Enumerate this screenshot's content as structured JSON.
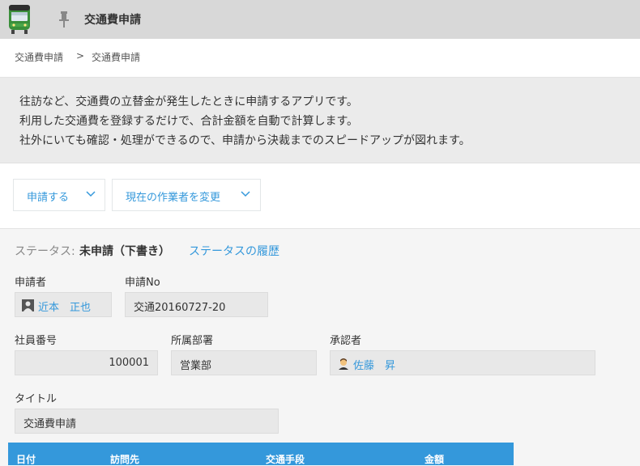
{
  "header": {
    "app_title": "交通費申請",
    "app_icon": "train-icon",
    "pin_icon": "pin-icon"
  },
  "breadcrumb": {
    "items": [
      "交通費申請",
      "交通費申請"
    ],
    "separator": ">"
  },
  "description": {
    "lines": [
      "往訪など、交通費の立替金が発生したときに申請するアプリです。",
      "利用した交通費を登録するだけで、合計金額を自動で計算します。",
      "社外にいても確認・処理ができるので、申請から決裁までのスピードアップが図れます。"
    ]
  },
  "actions": {
    "apply_label": "申請する",
    "change_assignee_label": "現在の作業者を変更"
  },
  "status": {
    "label": "ステータス:",
    "value": "未申請（下書き）",
    "history_link": "ステータスの履歴"
  },
  "fields": {
    "applicant": {
      "label": "申請者",
      "value": "近本　正也"
    },
    "application_no": {
      "label": "申請No",
      "value": "交通20160727-20"
    },
    "employee_no": {
      "label": "社員番号",
      "value": "100001"
    },
    "department": {
      "label": "所属部署",
      "value": "営業部"
    },
    "approver": {
      "label": "承認者",
      "value": "佐藤　昇"
    },
    "title": {
      "label": "タイトル",
      "value": "交通費申請"
    }
  },
  "table": {
    "columns": [
      "日付",
      "訪問先",
      "交通手段",
      "金額"
    ]
  },
  "colors": {
    "accent": "#3498db",
    "header_bg": "#d8d8d8",
    "description_bg": "#ebebeb"
  }
}
